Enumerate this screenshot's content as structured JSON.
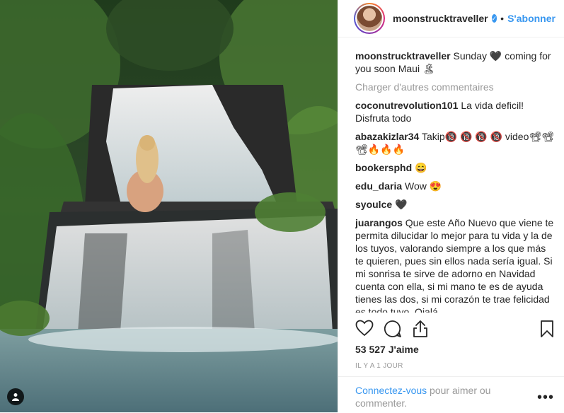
{
  "post": {
    "username": "moonstrucktraveller",
    "follow_label": "S'abonner",
    "separator": "•",
    "verified_mark": "✓"
  },
  "caption": {
    "username": "moonstrucktraveller",
    "text": "Sunday 🖤 coming for you soon Maui 🏝"
  },
  "load_more_label": "Charger d'autres commentaires",
  "comments": [
    {
      "username": "coconutrevolution101",
      "text": "La vida deficil! Disfruta todo"
    },
    {
      "username": "abazakizlar34",
      "text": "Takip🔞 🔞 🔞 🔞 video📽📽📽🔥🔥🔥"
    },
    {
      "username": "bookersphd",
      "text": "😄"
    },
    {
      "username": "edu_daria",
      "text": "Wow 😍"
    },
    {
      "username": "syoulce",
      "text": "🖤"
    },
    {
      "username": "juarangos",
      "text": "Que este Año Nuevo que viene te permita dilucidar lo mejor para tu vida y la de los tuyos, valorando siempre a los que más te quieren, pues sin ellos nada sería igual. Si mi sonrisa te sirve de adorno en Navidad cuenta con ella, si mi mano te es de ayuda tienes las dos, si mi corazón te trae felicidad es todo tuyo. Ojalá"
    }
  ],
  "likes_label": "53 527 J'aime",
  "timestamp": "IL Y A 1 JOUR",
  "footer": {
    "login_link": "Connectez-vous",
    "rest": " pour aimer ou commenter.",
    "more_label": "•••"
  },
  "icons": {
    "like": "heart-icon",
    "comment": "comment-icon",
    "share": "share-icon",
    "save": "bookmark-icon",
    "tagged": "user-tag-icon"
  }
}
